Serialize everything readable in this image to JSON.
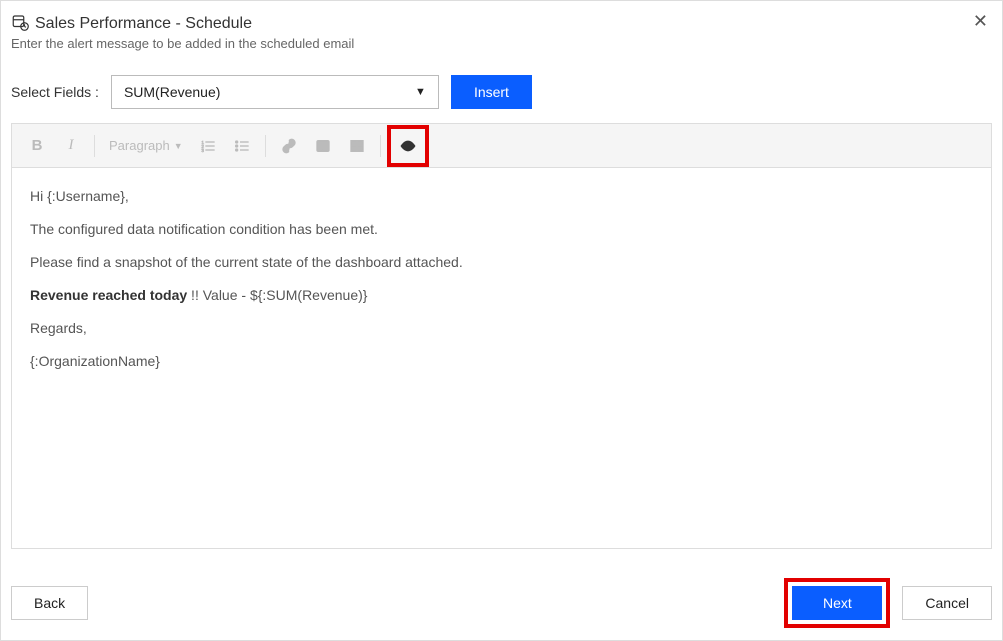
{
  "header": {
    "title": "Sales Performance - Schedule",
    "subtitle": "Enter the alert message to be added in the scheduled email"
  },
  "fields": {
    "label": "Select Fields :",
    "selected": "SUM(Revenue)",
    "insert_label": "Insert"
  },
  "toolbar": {
    "paragraph_label": "Paragraph"
  },
  "message": {
    "line1": "Hi {:Username},",
    "line2": "The configured data notification condition has been met.",
    "line3": "Please find a snapshot of the current state of the dashboard attached.",
    "line4_bold": "Revenue reached today",
    "line4_rest": " !! Value - ${:SUM(Revenue)}",
    "line5": "Regards,",
    "line6": "{:OrganizationName}"
  },
  "footer": {
    "back": "Back",
    "next": "Next",
    "cancel": "Cancel"
  }
}
